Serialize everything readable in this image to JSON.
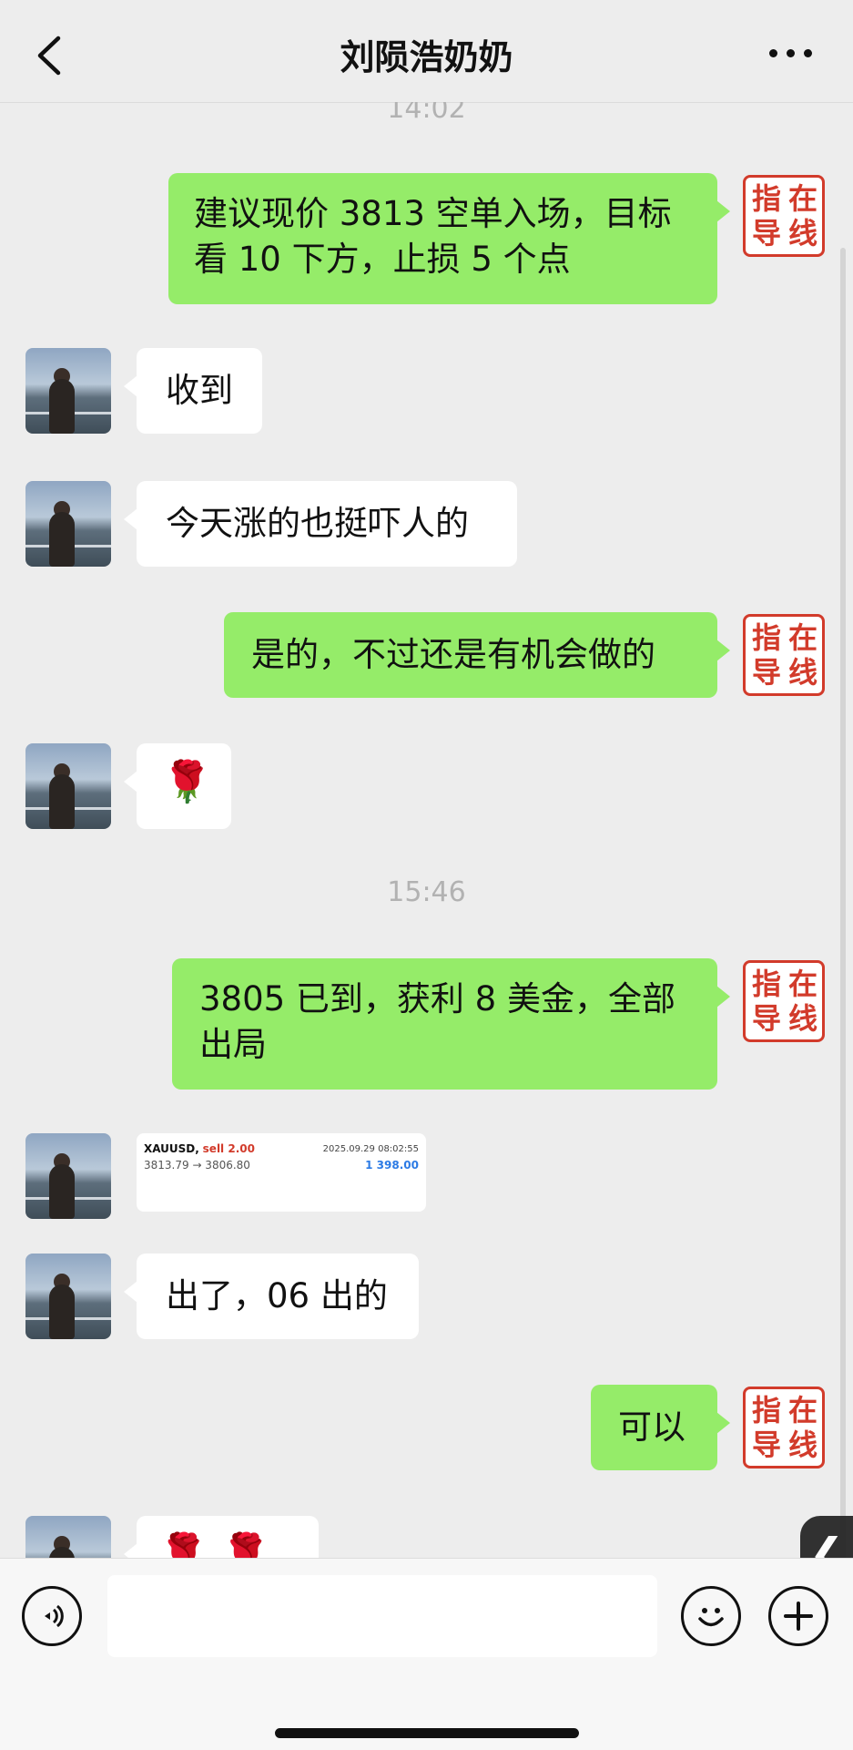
{
  "header": {
    "title": "刘陨浩奶奶"
  },
  "seal_text": [
    "指",
    "在",
    "导",
    "线"
  ],
  "messages": [
    {
      "type": "time",
      "text": "14:02"
    },
    {
      "type": "text",
      "side": "right",
      "lines": [
        "建议现价 3813 空单入场，目标",
        "看 10 下方，止损 5 个点"
      ]
    },
    {
      "type": "text",
      "side": "left",
      "text": "收到"
    },
    {
      "type": "text",
      "side": "left",
      "text": "今天涨的也挺吓人的"
    },
    {
      "type": "text",
      "side": "right",
      "text": "是的，不过还是有机会做的"
    },
    {
      "type": "emoji",
      "side": "left",
      "text": "🌹"
    },
    {
      "type": "time",
      "text": "15:46"
    },
    {
      "type": "text",
      "side": "right",
      "lines": [
        "3805 已到，获利 8 美金，全部",
        "出局"
      ]
    },
    {
      "type": "trade_card",
      "side": "left",
      "symbol": "XAUUSD,",
      "action": "sell 2.00",
      "datetime": "2025.09.29 08:02:55",
      "prices": "3813.79 → 3806.80",
      "profit": "1 398.00"
    },
    {
      "type": "text",
      "side": "left",
      "text": "出了，06 出的"
    },
    {
      "type": "text",
      "side": "right",
      "text": "可以"
    },
    {
      "type": "emoji",
      "side": "left",
      "text": "🌹 🌹 🌹"
    }
  ],
  "input": {
    "value": "",
    "placeholder": ""
  },
  "icons": {
    "back": "chevron-left-icon",
    "more": "more-dots-icon",
    "voice": "voice-icon",
    "emoji": "emoji-face-icon",
    "add": "plus-icon",
    "float": "chevron-left-icon"
  },
  "colors": {
    "background": "#ededed",
    "bubble_right": "#95ec69",
    "bubble_left": "#ffffff",
    "seal": "#d23b2b",
    "profit": "#2c7be5"
  }
}
